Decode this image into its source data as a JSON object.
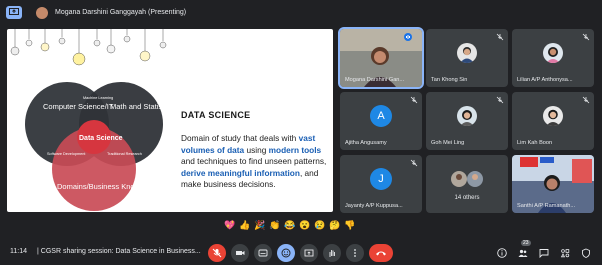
{
  "presenter": {
    "name": "Mogana Darshini Ganggayah (Presenting)"
  },
  "slide": {
    "venn": {
      "circle1": "Computer Science/IT",
      "circle2": "Math and Statistics",
      "circle3": "Domains/Business Knowledge",
      "center": "Data Science",
      "overlap12": "Machine Learning",
      "overlap13": "Software Development",
      "overlap23": "Traditional Research"
    },
    "title": "DATA SCIENCE",
    "body": {
      "p1": "Domain of study that deals with ",
      "b1": "vast volumes of data",
      "p2": " using ",
      "b2": "modern tools",
      "p3": " and techniques to find unseen patterns, ",
      "b3": "derive meaningful information",
      "p4": ", and make business decisions."
    }
  },
  "participants": [
    {
      "name": "Mogana Darshini Gan...",
      "kind": "video"
    },
    {
      "name": "Tan Khong Sin",
      "kind": "photo"
    },
    {
      "name": "Lilian A/P Anthonysa...",
      "kind": "photo"
    },
    {
      "name": "Ajitha Angusamy",
      "kind": "letter",
      "letter": "A"
    },
    {
      "name": "Goh Mei Ling",
      "kind": "photo"
    },
    {
      "name": "Lim Kah Boon",
      "kind": "photo"
    },
    {
      "name": "Jayanty A/P Kuppusa...",
      "kind": "letter",
      "letter": "J"
    },
    {
      "name": "14 others",
      "kind": "others"
    },
    {
      "name": "Santhi A/P Ramanath...",
      "kind": "video"
    }
  ],
  "reactions": [
    "💖",
    "👍",
    "🎉",
    "👏",
    "😂",
    "😮",
    "😢",
    "🤔",
    "👎"
  ],
  "bottom": {
    "time": "11:14",
    "divider": "|",
    "meeting": "CGSR sharing session: Data Science in Business...",
    "participant_count": "23"
  }
}
